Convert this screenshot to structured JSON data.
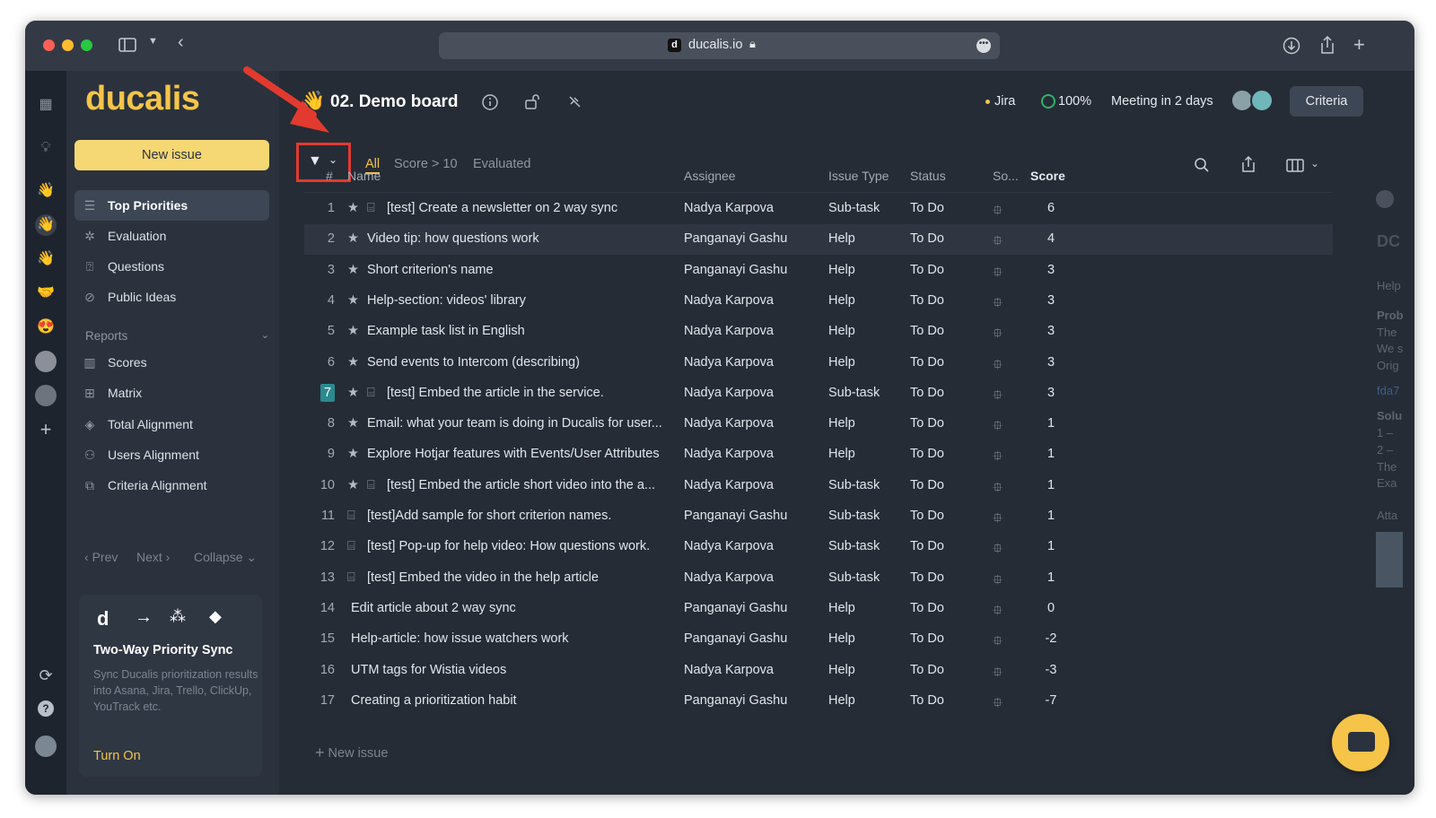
{
  "browser": {
    "url": "ducalis.io",
    "favicon_letter": "d"
  },
  "logo": "ducalis",
  "sidebar": {
    "new_issue": "New issue",
    "items": [
      {
        "label": "Top Priorities",
        "icon": "list-icon"
      },
      {
        "label": "Evaluation",
        "icon": "evaluation-icon"
      },
      {
        "label": "Questions",
        "icon": "question-box-icon"
      },
      {
        "label": "Public Ideas",
        "icon": "public-ideas-icon"
      }
    ],
    "reports_label": "Reports",
    "reports": [
      {
        "label": "Scores",
        "icon": "columns-icon"
      },
      {
        "label": "Matrix",
        "icon": "grid-icon"
      },
      {
        "label": "Total Alignment",
        "icon": "layers-icon"
      },
      {
        "label": "Users Alignment",
        "icon": "users-icon"
      },
      {
        "label": "Criteria Alignment",
        "icon": "criteria-icon"
      }
    ],
    "prev": "Prev",
    "next": "Next",
    "collapse": "Collapse",
    "promo": {
      "title": "Two-Way Priority Sync",
      "text": "Sync Ducalis prioritization results into Asana, Jira, Trello, ClickUp, YouTrack etc.",
      "cta": "Turn On",
      "logo_letter": "d"
    }
  },
  "board": {
    "emoji": "👋",
    "title": "02. Demo board",
    "jira": "Jira",
    "progress": "100%",
    "meeting": "Meeting in 2 days",
    "criteria": "Criteria",
    "filters": [
      "All",
      "Score > 10",
      "Evaluated"
    ],
    "new_issue": "New issue"
  },
  "table": {
    "columns": {
      "num": "#",
      "name": "Name",
      "assignee": "Assignee",
      "type": "Issue Type",
      "status": "Status",
      "source": "So...",
      "score": "Score"
    },
    "rows": [
      {
        "n": "1",
        "name": "[test] Create a newsletter on 2 way sync",
        "assignee": "Nadya Karpova",
        "type": "Sub-task",
        "status": "To Do",
        "score": "6",
        "star": true,
        "subtask": true
      },
      {
        "n": "2",
        "name": "Video tip: how questions work",
        "assignee": "Panganayi Gashu",
        "type": "Help",
        "status": "To Do",
        "score": "4",
        "star": true,
        "subtask": false
      },
      {
        "n": "3",
        "name": "Short criterion's name",
        "assignee": "Panganayi Gashu",
        "type": "Help",
        "status": "To Do",
        "score": "3",
        "star": true,
        "subtask": false
      },
      {
        "n": "4",
        "name": "Help-section: videos' library",
        "assignee": "Nadya Karpova",
        "type": "Help",
        "status": "To Do",
        "score": "3",
        "star": true,
        "subtask": false
      },
      {
        "n": "5",
        "name": "Example task list in English",
        "assignee": "Nadya Karpova",
        "type": "Help",
        "status": "To Do",
        "score": "3",
        "star": true,
        "subtask": false
      },
      {
        "n": "6",
        "name": "Send events to Intercom (describing)",
        "assignee": "Nadya Karpova",
        "type": "Help",
        "status": "To Do",
        "score": "3",
        "star": true,
        "subtask": false
      },
      {
        "n": "7",
        "name": "[test] Embed the article in the service.",
        "assignee": "Nadya Karpova",
        "type": "Sub-task",
        "status": "To Do",
        "score": "3",
        "star": true,
        "subtask": true
      },
      {
        "n": "8",
        "name": "Email: what your team is doing in Ducalis for user...",
        "assignee": "Nadya Karpova",
        "type": "Help",
        "status": "To Do",
        "score": "1",
        "star": true,
        "subtask": false
      },
      {
        "n": "9",
        "name": "Explore Hotjar features with Events/User Attributes",
        "assignee": "Nadya Karpova",
        "type": "Help",
        "status": "To Do",
        "score": "1",
        "star": true,
        "subtask": false
      },
      {
        "n": "10",
        "name": "[test] Embed the article short video into the a...",
        "assignee": "Nadya Karpova",
        "type": "Sub-task",
        "status": "To Do",
        "score": "1",
        "star": true,
        "subtask": true
      },
      {
        "n": "11",
        "name": "[test]Add sample for short criterion names.",
        "assignee": "Panganayi Gashu",
        "type": "Sub-task",
        "status": "To Do",
        "score": "1",
        "star": false,
        "subtask": true
      },
      {
        "n": "12",
        "name": "[test] Pop-up for help video: How questions work.",
        "assignee": "Nadya Karpova",
        "type": "Sub-task",
        "status": "To Do",
        "score": "1",
        "star": false,
        "subtask": true
      },
      {
        "n": "13",
        "name": "[test] Embed the video in the help article",
        "assignee": "Nadya Karpova",
        "type": "Sub-task",
        "status": "To Do",
        "score": "1",
        "star": false,
        "subtask": true
      },
      {
        "n": "14",
        "name": "Edit article about 2 way sync",
        "assignee": "Panganayi Gashu",
        "type": "Help",
        "status": "To Do",
        "score": "0",
        "star": false,
        "subtask": false
      },
      {
        "n": "15",
        "name": "Help-article: how issue watchers work",
        "assignee": "Panganayi Gashu",
        "type": "Help",
        "status": "To Do",
        "score": "-2",
        "star": false,
        "subtask": false
      },
      {
        "n": "16",
        "name": "UTM tags for Wistia videos",
        "assignee": "Nadya Karpova",
        "type": "Help",
        "status": "To Do",
        "score": "-3",
        "star": false,
        "subtask": false
      },
      {
        "n": "17",
        "name": "Creating a prioritization habit",
        "assignee": "Panganayi Gashu",
        "type": "Help",
        "status": "To Do",
        "score": "-7",
        "star": false,
        "subtask": false
      }
    ]
  },
  "right_panel": {
    "lines": [
      "DC",
      "Help",
      "Prob",
      "The",
      "We s",
      "Orig",
      "fda7",
      "Solu",
      "1 –",
      "2 –",
      "The",
      "Exa",
      "Atta"
    ]
  },
  "colors": {
    "accent": "#f5c449",
    "highlight": "#e23a2e",
    "background": "#252c36",
    "sidebar": "#2b323d",
    "progress": "#2fb36b"
  }
}
